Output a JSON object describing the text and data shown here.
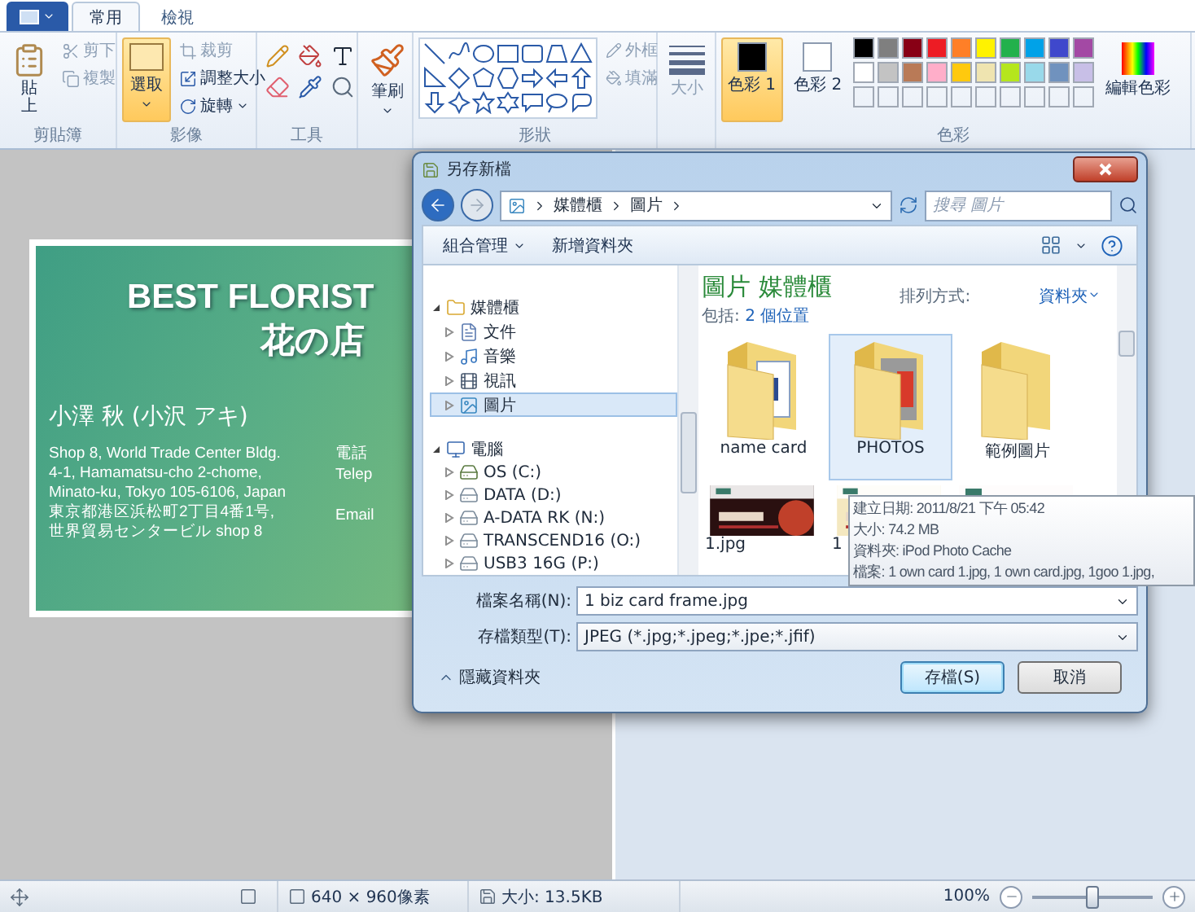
{
  "ribbon_tabs": [
    {
      "label": "常用",
      "selected": true
    },
    {
      "label": "檢視",
      "selected": false
    }
  ],
  "ribbon": {
    "clipboard": {
      "paste": "貼上",
      "cut": "剪下",
      "copy": "複製",
      "group": "剪貼簿"
    },
    "image": {
      "select": "選取",
      "crop": "裁剪",
      "resize": "調整大小",
      "rotate": "旋轉",
      "group": "影像"
    },
    "tools": {
      "group": "工具"
    },
    "brushes": {
      "label": "筆刷"
    },
    "shapes": {
      "outline": "外框",
      "fill": "填滿",
      "group": "形狀"
    },
    "size": {
      "label": "大小"
    },
    "colors": {
      "group": "色彩",
      "edit": "編輯色彩",
      "active": [
        {
          "label": "色彩 1",
          "color": "#000000",
          "selected": true
        },
        {
          "label": "色彩 2",
          "color": "#ffffff",
          "selected": false
        }
      ],
      "palette": [
        {
          "color": "#000000"
        },
        {
          "color": "#7f7f7f"
        },
        {
          "color": "#880015"
        },
        {
          "color": "#ed1c24"
        },
        {
          "color": "#ff7f27"
        },
        {
          "color": "#fff200"
        },
        {
          "color": "#22b14c"
        },
        {
          "color": "#00a2e8"
        },
        {
          "color": "#3f48cc"
        },
        {
          "color": "#a349a4"
        },
        {
          "color": "#ffffff"
        },
        {
          "color": "#c3c3c3"
        },
        {
          "color": "#b97a57"
        },
        {
          "color": "#ffaec9"
        },
        {
          "color": "#ffc90e"
        },
        {
          "color": "#efe4b0"
        },
        {
          "color": "#b5e61d"
        },
        {
          "color": "#99d9ea"
        },
        {
          "color": "#7092be"
        },
        {
          "color": "#c8bfe7"
        }
      ]
    }
  },
  "card": {
    "title": "BEST FLORIST",
    "subtitle": "花の店",
    "name": "小澤 秋 (小沢 アキ)",
    "address": [
      "Shop 8, World Trade Center Bldg.",
      "4-1, Hamamatsu-cho 2-chome,",
      "Minato-ku, Tokyo 105-6106, Japan",
      "東京都港区浜松町2丁目4番1号,",
      "世界貿易センタービル shop 8"
    ],
    "contact": [
      "電話",
      "Telep",
      "Email"
    ]
  },
  "dialog": {
    "title": "另存新檔",
    "breadcrumbs": [
      "媒體櫃",
      "圖片"
    ],
    "search": {
      "placeholder": "搜尋 圖片"
    },
    "toolbar": [
      {
        "label": "組合管理",
        "dropdown": true
      },
      {
        "label": "新增資料夾",
        "dropdown": false
      }
    ],
    "nav_tree": [
      {
        "label": "媒體櫃",
        "kind": "library",
        "expanded": true,
        "selected": false,
        "children": [
          {
            "label": "文件",
            "kind": "documents",
            "expanded": false,
            "selected": false
          },
          {
            "label": "音樂",
            "kind": "music",
            "expanded": false,
            "selected": false
          },
          {
            "label": "視訊",
            "kind": "video",
            "expanded": false,
            "selected": false
          },
          {
            "label": "圖片",
            "kind": "pictures",
            "expanded": false,
            "selected": true
          }
        ]
      },
      {
        "label": "電腦",
        "kind": "computer",
        "expanded": true,
        "selected": false,
        "children": [
          {
            "label": "OS (C:)",
            "kind": "system-drive",
            "expanded": false,
            "selected": false
          },
          {
            "label": "DATA (D:)",
            "kind": "drive",
            "expanded": false,
            "selected": false
          },
          {
            "label": "A-DATA RK (N:)",
            "kind": "drive",
            "expanded": false,
            "selected": false
          },
          {
            "label": "TRANSCEND16 (O:)",
            "kind": "drive",
            "expanded": false,
            "selected": false
          },
          {
            "label": "USB3 16G (P:)",
            "kind": "drive",
            "expanded": false,
            "selected": false
          }
        ]
      }
    ],
    "library": {
      "title": "圖片 媒體櫃",
      "includes_label": "包括:",
      "includes_link": "2 個位置",
      "arrange_label": "排列方式:",
      "arrange_value": "資料夾"
    },
    "items": [
      {
        "name": "name card",
        "kind": "folder",
        "selected": false
      },
      {
        "name": "PHOTOS",
        "kind": "folder",
        "selected": true
      },
      {
        "name": "範例圖片",
        "kind": "folder",
        "selected": false
      },
      {
        "name": "1.jpg",
        "kind": "picture",
        "selected": false
      },
      {
        "name": "1",
        "kind": "picture",
        "selected": false
      },
      {
        "kind": "picture",
        "selected": false
      }
    ],
    "tooltip": [
      "建立日期: 2011/8/21 下午 05:42",
      "大小: 74.2 MB",
      "資料夾: iPod Photo Cache",
      "檔案: 1 own card 1.jpg, 1 own card.jpg, 1goo 1.jpg,"
    ],
    "filename": {
      "label": "檔案名稱(N):",
      "value": "1 biz card frame.jpg"
    },
    "filetype": {
      "label": "存檔類型(T):",
      "value": "JPEG (*.jpg;*.jpeg;*.jpe;*.jfif)"
    },
    "hide_folders": "隱藏資料夾",
    "buttons": [
      {
        "label": "存檔(S)",
        "default": true
      },
      {
        "label": "取消",
        "default": false
      }
    ]
  },
  "status_bar": {
    "dimensions": "640 × 960像素",
    "size": "大小: 13.5KB",
    "zoom": "100%",
    "zoom_slider": {
      "level": 0.5
    }
  }
}
